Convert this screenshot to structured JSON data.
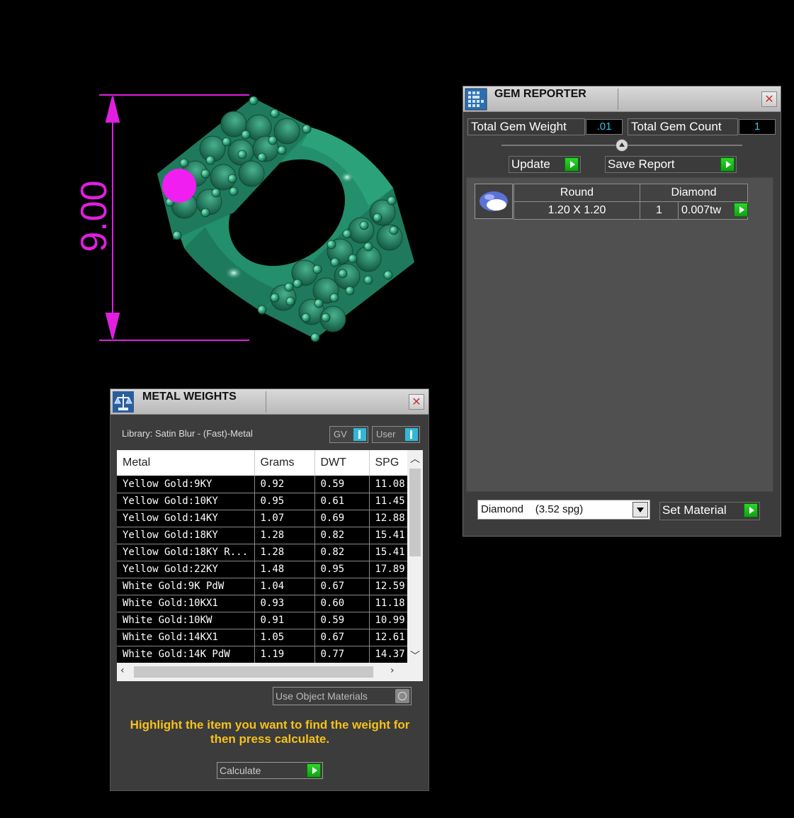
{
  "viewport": {
    "dimension_label": "9.00",
    "colors": {
      "ring": "#238f6c",
      "dimension": "#e01fe0",
      "highlight": "#f01ef0"
    }
  },
  "gem_reporter": {
    "title": "GEM REPORTER",
    "close_glyph": "✕",
    "total_weight_label": "Total Gem Weight",
    "total_weight_value": ".01",
    "total_count_label": "Total Gem Count",
    "total_count_value": "1",
    "update_label": "Update",
    "save_report_label": "Save Report",
    "gem": {
      "shape": "Round",
      "material": "Diamond",
      "size": "1.20 X 1.20",
      "count": "1",
      "weight": "0.007tw"
    },
    "material_select_value": "Diamond    (3.52 spg)",
    "set_material_label": "Set Material"
  },
  "metal_weights": {
    "title": "METAL WEIGHTS",
    "close_glyph": "✕",
    "library_label": "Library: Satin Blur - (Fast)-Metal",
    "gv_label": "GV",
    "user_label": "User",
    "columns": [
      "Metal",
      "Grams",
      "DWT",
      "SPG"
    ],
    "rows": [
      {
        "metal": "Yellow Gold:9KY",
        "grams": "0.92",
        "dwt": "0.59",
        "spg": "11.08"
      },
      {
        "metal": "Yellow Gold:10KY",
        "grams": "0.95",
        "dwt": "0.61",
        "spg": "11.45"
      },
      {
        "metal": "Yellow Gold:14KY",
        "grams": "1.07",
        "dwt": "0.69",
        "spg": "12.88"
      },
      {
        "metal": "Yellow Gold:18KY",
        "grams": "1.28",
        "dwt": "0.82",
        "spg": "15.41"
      },
      {
        "metal": "Yellow Gold:18KY R...",
        "grams": "1.28",
        "dwt": "0.82",
        "spg": "15.41"
      },
      {
        "metal": "Yellow Gold:22KY",
        "grams": "1.48",
        "dwt": "0.95",
        "spg": "17.89"
      },
      {
        "metal": "White Gold:9K PdW",
        "grams": "1.04",
        "dwt": "0.67",
        "spg": "12.59"
      },
      {
        "metal": "White Gold:10KX1",
        "grams": "0.93",
        "dwt": "0.60",
        "spg": "11.18"
      },
      {
        "metal": "White Gold:10KW",
        "grams": "0.91",
        "dwt": "0.59",
        "spg": "10.99"
      },
      {
        "metal": "White Gold:14KX1",
        "grams": "1.05",
        "dwt": "0.67",
        "spg": "12.61"
      },
      {
        "metal": "White Gold:14K PdW",
        "grams": "1.19",
        "dwt": "0.77",
        "spg": "14.37"
      }
    ],
    "use_object_materials_label": "Use Object Materials",
    "hint_text": "Highlight the item you want to find the weight for then press calculate.",
    "calculate_label": "Calculate"
  }
}
